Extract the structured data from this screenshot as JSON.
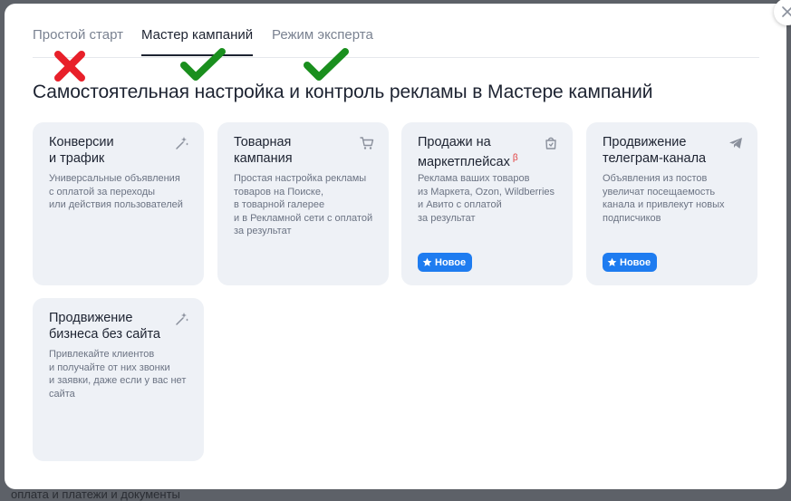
{
  "background": {
    "footer_text": "оплата и платежи и документы"
  },
  "modal": {
    "close_symbol": "×"
  },
  "tabs": [
    {
      "label": "Простой старт",
      "active": false
    },
    {
      "label": "Мастер кампаний",
      "active": true
    },
    {
      "label": "Режим эксперта",
      "active": false
    }
  ],
  "annotations": [
    "red-cross-mark",
    "green-check-mark",
    "green-check-mark"
  ],
  "heading": "Самостоятельная настройка и контроль рекламы в Мастере кампаний",
  "cards": [
    {
      "title": "Конверсии\nи трафик",
      "description": "Универсальные объявления\nс оплатой за переходы\nили действия пользователей",
      "icon": "magic-wand-icon"
    },
    {
      "title": "Товарная\nкампания",
      "description": "Простая настройка рекламы\nтоваров на Поиске,\nв товарной галерее\nи в Рекламной сети с оплатой\nза результат",
      "icon": "shopping-cart-icon"
    },
    {
      "title": "Продажи на\nмаркетплейсах",
      "beta": "β",
      "description": "Реклама ваших товаров\nиз Маркета, Ozon, Wildberries\nи Авито с оплатой\nза результат",
      "icon": "shopping-bag-icon",
      "badge": "Новое"
    },
    {
      "title": "Продвижение\nтелеграм-канала",
      "description": "Объявления из постов\nувеличат посещаемость\nканала и привлекут новых\nподписчиков",
      "icon": "telegram-plane-icon",
      "badge": "Новое"
    },
    {
      "title": "Продвижение\nбизнеса без сайта",
      "description": "Привлекайте клиентов\nи получайте от них звонки\nи заявки, даже если у вас нет\nсайта",
      "icon": "magic-wand-icon"
    }
  ],
  "colors": {
    "accent_blue": "#1e7cf0",
    "card_bg": "#eef1f6",
    "beta_red": "#e23b3b",
    "check_green": "#1a8f1e",
    "cross_red": "#e8202a"
  }
}
